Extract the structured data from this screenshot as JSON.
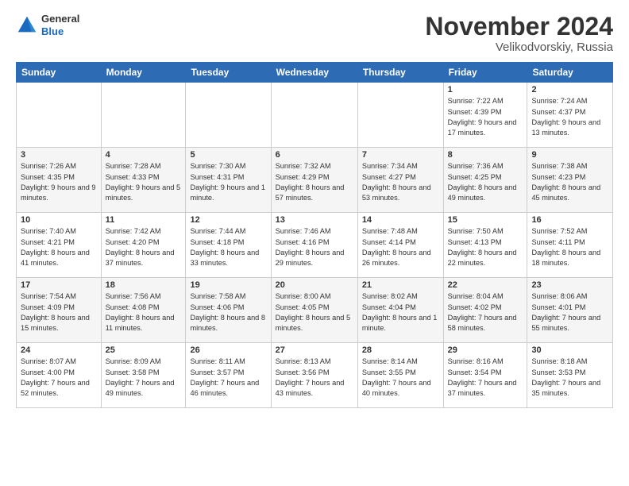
{
  "logo": {
    "general": "General",
    "blue": "Blue"
  },
  "header": {
    "month": "November 2024",
    "location": "Velikodvorskiy, Russia"
  },
  "weekdays": [
    "Sunday",
    "Monday",
    "Tuesday",
    "Wednesday",
    "Thursday",
    "Friday",
    "Saturday"
  ],
  "weeks": [
    [
      {
        "day": "",
        "info": ""
      },
      {
        "day": "",
        "info": ""
      },
      {
        "day": "",
        "info": ""
      },
      {
        "day": "",
        "info": ""
      },
      {
        "day": "",
        "info": ""
      },
      {
        "day": "1",
        "info": "Sunrise: 7:22 AM\nSunset: 4:39 PM\nDaylight: 9 hours and 17 minutes."
      },
      {
        "day": "2",
        "info": "Sunrise: 7:24 AM\nSunset: 4:37 PM\nDaylight: 9 hours and 13 minutes."
      }
    ],
    [
      {
        "day": "3",
        "info": "Sunrise: 7:26 AM\nSunset: 4:35 PM\nDaylight: 9 hours and 9 minutes."
      },
      {
        "day": "4",
        "info": "Sunrise: 7:28 AM\nSunset: 4:33 PM\nDaylight: 9 hours and 5 minutes."
      },
      {
        "day": "5",
        "info": "Sunrise: 7:30 AM\nSunset: 4:31 PM\nDaylight: 9 hours and 1 minute."
      },
      {
        "day": "6",
        "info": "Sunrise: 7:32 AM\nSunset: 4:29 PM\nDaylight: 8 hours and 57 minutes."
      },
      {
        "day": "7",
        "info": "Sunrise: 7:34 AM\nSunset: 4:27 PM\nDaylight: 8 hours and 53 minutes."
      },
      {
        "day": "8",
        "info": "Sunrise: 7:36 AM\nSunset: 4:25 PM\nDaylight: 8 hours and 49 minutes."
      },
      {
        "day": "9",
        "info": "Sunrise: 7:38 AM\nSunset: 4:23 PM\nDaylight: 8 hours and 45 minutes."
      }
    ],
    [
      {
        "day": "10",
        "info": "Sunrise: 7:40 AM\nSunset: 4:21 PM\nDaylight: 8 hours and 41 minutes."
      },
      {
        "day": "11",
        "info": "Sunrise: 7:42 AM\nSunset: 4:20 PM\nDaylight: 8 hours and 37 minutes."
      },
      {
        "day": "12",
        "info": "Sunrise: 7:44 AM\nSunset: 4:18 PM\nDaylight: 8 hours and 33 minutes."
      },
      {
        "day": "13",
        "info": "Sunrise: 7:46 AM\nSunset: 4:16 PM\nDaylight: 8 hours and 29 minutes."
      },
      {
        "day": "14",
        "info": "Sunrise: 7:48 AM\nSunset: 4:14 PM\nDaylight: 8 hours and 26 minutes."
      },
      {
        "day": "15",
        "info": "Sunrise: 7:50 AM\nSunset: 4:13 PM\nDaylight: 8 hours and 22 minutes."
      },
      {
        "day": "16",
        "info": "Sunrise: 7:52 AM\nSunset: 4:11 PM\nDaylight: 8 hours and 18 minutes."
      }
    ],
    [
      {
        "day": "17",
        "info": "Sunrise: 7:54 AM\nSunset: 4:09 PM\nDaylight: 8 hours and 15 minutes."
      },
      {
        "day": "18",
        "info": "Sunrise: 7:56 AM\nSunset: 4:08 PM\nDaylight: 8 hours and 11 minutes."
      },
      {
        "day": "19",
        "info": "Sunrise: 7:58 AM\nSunset: 4:06 PM\nDaylight: 8 hours and 8 minutes."
      },
      {
        "day": "20",
        "info": "Sunrise: 8:00 AM\nSunset: 4:05 PM\nDaylight: 8 hours and 5 minutes."
      },
      {
        "day": "21",
        "info": "Sunrise: 8:02 AM\nSunset: 4:04 PM\nDaylight: 8 hours and 1 minute."
      },
      {
        "day": "22",
        "info": "Sunrise: 8:04 AM\nSunset: 4:02 PM\nDaylight: 7 hours and 58 minutes."
      },
      {
        "day": "23",
        "info": "Sunrise: 8:06 AM\nSunset: 4:01 PM\nDaylight: 7 hours and 55 minutes."
      }
    ],
    [
      {
        "day": "24",
        "info": "Sunrise: 8:07 AM\nSunset: 4:00 PM\nDaylight: 7 hours and 52 minutes."
      },
      {
        "day": "25",
        "info": "Sunrise: 8:09 AM\nSunset: 3:58 PM\nDaylight: 7 hours and 49 minutes."
      },
      {
        "day": "26",
        "info": "Sunrise: 8:11 AM\nSunset: 3:57 PM\nDaylight: 7 hours and 46 minutes."
      },
      {
        "day": "27",
        "info": "Sunrise: 8:13 AM\nSunset: 3:56 PM\nDaylight: 7 hours and 43 minutes."
      },
      {
        "day": "28",
        "info": "Sunrise: 8:14 AM\nSunset: 3:55 PM\nDaylight: 7 hours and 40 minutes."
      },
      {
        "day": "29",
        "info": "Sunrise: 8:16 AM\nSunset: 3:54 PM\nDaylight: 7 hours and 37 minutes."
      },
      {
        "day": "30",
        "info": "Sunrise: 8:18 AM\nSunset: 3:53 PM\nDaylight: 7 hours and 35 minutes."
      }
    ]
  ]
}
